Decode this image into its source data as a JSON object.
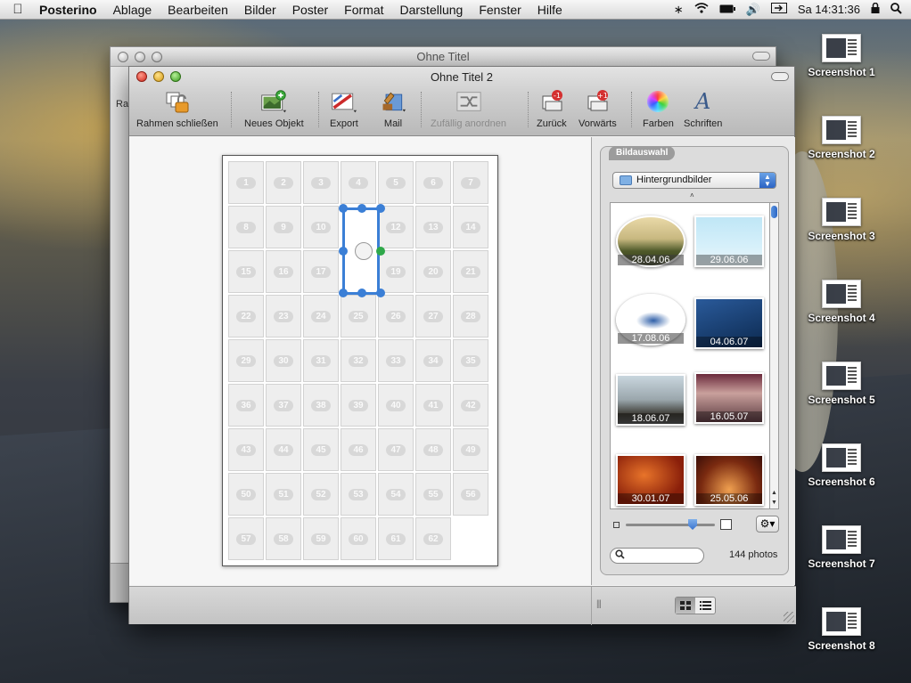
{
  "menubar": {
    "app": "Posterino",
    "items": [
      "Ablage",
      "Bearbeiten",
      "Bilder",
      "Poster",
      "Format",
      "Darstellung",
      "Fenster",
      "Hilfe"
    ],
    "clock": "Sa 14:31:36"
  },
  "desktop": {
    "icons": [
      "Screenshot 1",
      "Screenshot 2",
      "Screenshot 3",
      "Screenshot 4",
      "Screenshot 5",
      "Screenshot 6",
      "Screenshot 7",
      "Screenshot 8"
    ]
  },
  "back_window": {
    "title": "Ohne Titel",
    "edge_text": "Ra"
  },
  "main_window": {
    "title": "Ohne Titel 2",
    "toolbar": {
      "close_frame": "Rahmen schließen",
      "new_object": "Neues Objekt",
      "export": "Export",
      "mail": "Mail",
      "shuffle": "Zufällig anordnen",
      "back": "Zurück",
      "forward": "Vorwärts",
      "colors": "Farben",
      "fonts": "Schriften"
    },
    "poster_cells": [
      1,
      2,
      3,
      4,
      5,
      6,
      7,
      8,
      9,
      10,
      11,
      12,
      13,
      14,
      15,
      16,
      17,
      18,
      19,
      20,
      21,
      22,
      23,
      24,
      25,
      26,
      27,
      28,
      29,
      30,
      31,
      32,
      33,
      34,
      35,
      36,
      37,
      38,
      39,
      40,
      41,
      42,
      43,
      44,
      45,
      46,
      47,
      48,
      49,
      50,
      51,
      52,
      53,
      54,
      55,
      56,
      57,
      58,
      59,
      60,
      61,
      62
    ]
  },
  "panel": {
    "tab": "Bildauswahl",
    "folder": "Hintergrundbilder",
    "photos": [
      "28.04.06",
      "29.06.06",
      "17.08.06",
      "04.06.07",
      "18.06.07",
      "16.05.07",
      "30.01.07",
      "25.05.06"
    ],
    "count": "144 photos"
  },
  "colors": {
    "accent": "#3b7fd6",
    "handle_green": "#2fa84a"
  }
}
